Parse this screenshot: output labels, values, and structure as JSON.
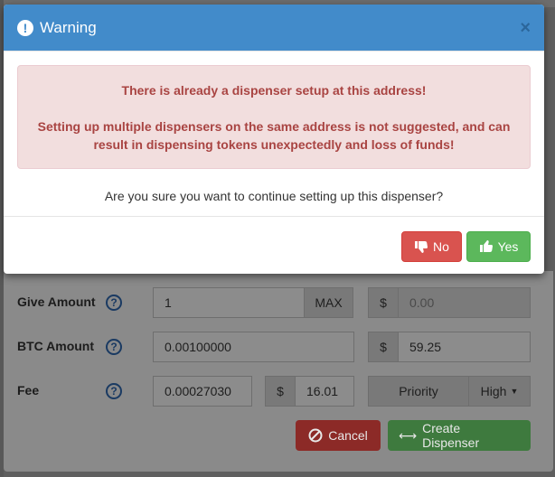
{
  "background": {
    "give_amount": {
      "label": "Give Amount",
      "value": "1",
      "max_label": "MAX",
      "usd_symbol": "$",
      "usd_placeholder": "0.00"
    },
    "btc_amount": {
      "label": "BTC Amount",
      "value": "0.00100000",
      "usd_symbol": "$",
      "usd_value": "59.25"
    },
    "fee": {
      "label": "Fee",
      "value": "0.00027030",
      "usd_symbol": "$",
      "usd_value": "16.01",
      "priority_label": "Priority",
      "priority_value": "High"
    },
    "help_symbol": "?",
    "cancel_label": "Cancel",
    "create_label": "Create Dispenser"
  },
  "modal": {
    "icon_symbol": "!",
    "title": "Warning",
    "close_symbol": "×",
    "alert_line1": "There is already a dispenser setup at this address!",
    "alert_line2": "Setting up multiple dispensers on the same address is not suggested, and can result in dispensing tokens unexpectedly and loss of funds!",
    "question": "Are you sure you want to continue setting up this dispenser?",
    "no_label": "No",
    "yes_label": "Yes"
  },
  "colors": {
    "header": "#428bca",
    "alert_bg": "#f2dede",
    "alert_text": "#a94442",
    "danger": "#d9534f",
    "success": "#5cb85c"
  }
}
